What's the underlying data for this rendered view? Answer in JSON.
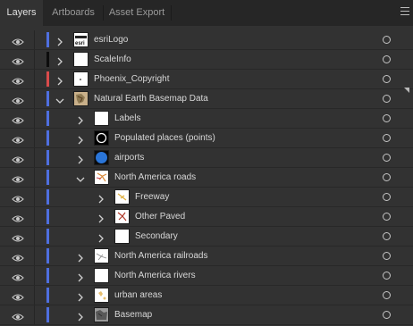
{
  "tabs": [
    {
      "label": "Layers",
      "active": true
    },
    {
      "label": "Artboards",
      "active": false
    },
    {
      "label": "Asset Export",
      "active": false
    }
  ],
  "panel_menu_icon": "hamburger-menu-icon",
  "colors": {
    "blue": "#4f6fe0",
    "black": "#0d0d0d",
    "red": "#d94b4b"
  },
  "layers": [
    {
      "label": "esriLogo",
      "depth": 0,
      "expanded": false,
      "color": "blue",
      "thumb": "esri"
    },
    {
      "label": "ScaleInfo",
      "depth": 0,
      "expanded": false,
      "color": "black",
      "thumb": "blank"
    },
    {
      "label": "Phoenix_Copyright",
      "depth": 0,
      "expanded": false,
      "color": "red",
      "thumb": "dot"
    },
    {
      "label": "Natural Earth Basemap Data",
      "depth": 0,
      "expanded": true,
      "color": "blue",
      "thumb": "map"
    },
    {
      "label": "Labels",
      "depth": 1,
      "expanded": false,
      "color": "blue",
      "thumb": "blank"
    },
    {
      "label": "Populated places (points)",
      "depth": 1,
      "expanded": false,
      "color": "blue",
      "thumb": "ring"
    },
    {
      "label": "airports",
      "depth": 1,
      "expanded": false,
      "color": "blue",
      "thumb": "bluedot"
    },
    {
      "label": "North America roads",
      "depth": 1,
      "expanded": true,
      "color": "blue",
      "thumb": "roads"
    },
    {
      "label": "Freeway",
      "depth": 2,
      "expanded": false,
      "color": "blue",
      "thumb": "freeway"
    },
    {
      "label": "Other Paved",
      "depth": 2,
      "expanded": false,
      "color": "blue",
      "thumb": "paved"
    },
    {
      "label": "Secondary",
      "depth": 2,
      "expanded": false,
      "color": "blue",
      "thumb": "blank"
    },
    {
      "label": "North America railroads",
      "depth": 1,
      "expanded": false,
      "color": "blue",
      "thumb": "rail"
    },
    {
      "label": "North America rivers",
      "depth": 1,
      "expanded": false,
      "color": "blue",
      "thumb": "blank"
    },
    {
      "label": "urban areas",
      "depth": 1,
      "expanded": false,
      "color": "blue",
      "thumb": "urban"
    },
    {
      "label": "Basemap",
      "depth": 1,
      "expanded": false,
      "color": "blue",
      "thumb": "basemap"
    }
  ]
}
